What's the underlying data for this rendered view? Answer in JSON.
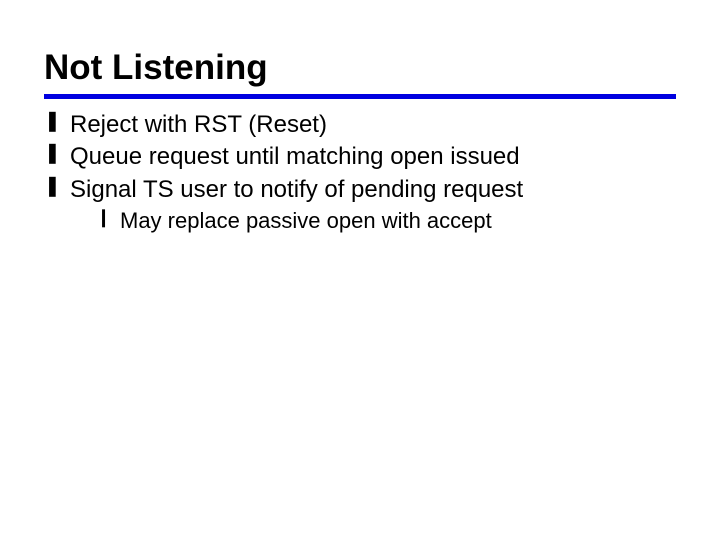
{
  "title": "Not Listening",
  "bullets": [
    {
      "glyph": "❚",
      "text": "Reject with RST (Reset)"
    },
    {
      "glyph": "❚",
      "text": "Queue request until matching open issued"
    },
    {
      "glyph": "❚",
      "text": "Signal TS user to notify of pending request",
      "sub": [
        {
          "glyph": "❙",
          "text": "May replace passive open with accept"
        }
      ]
    }
  ],
  "colors": {
    "rule": "#0000e0"
  }
}
